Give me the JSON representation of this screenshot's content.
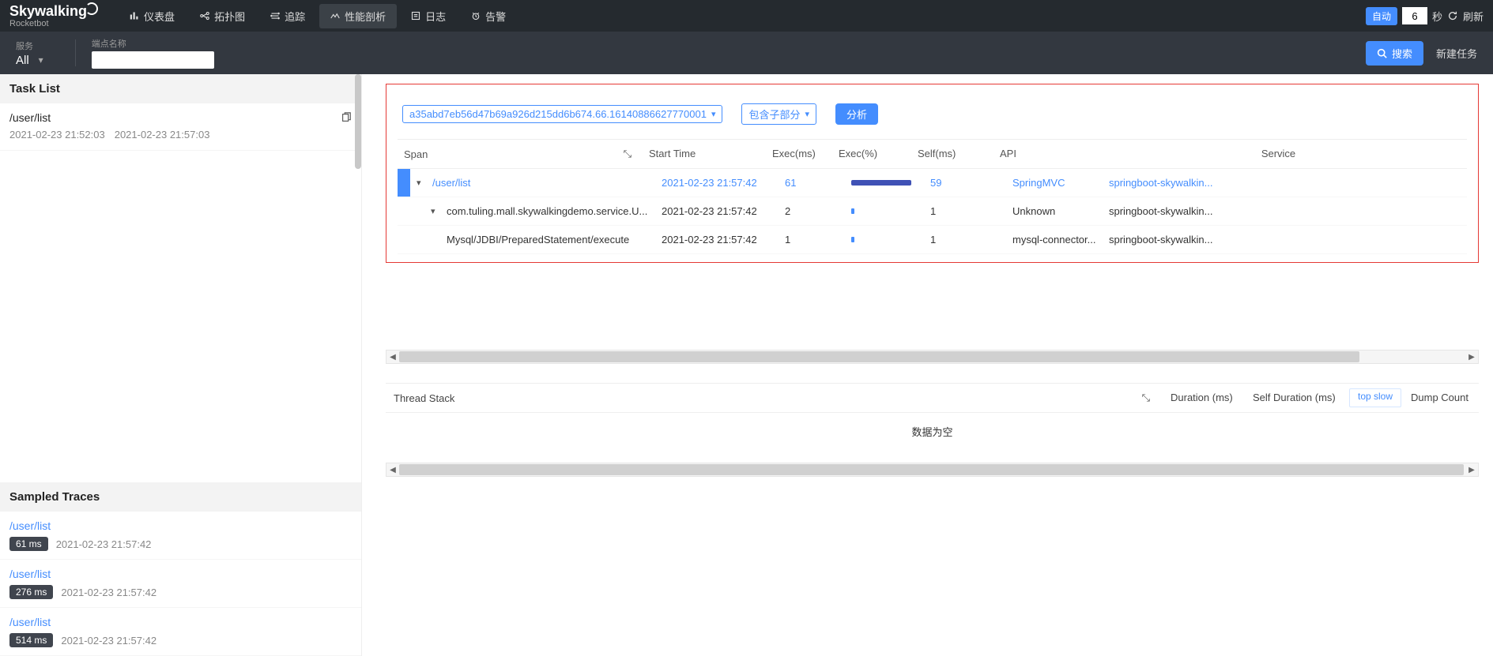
{
  "logo": {
    "main": "Skywalking",
    "sub": "Rocketbot"
  },
  "nav": {
    "dashboard": "仪表盘",
    "topology": "拓扑图",
    "trace": "追踪",
    "profile": "性能剖析",
    "log": "日志",
    "alarm": "告警"
  },
  "topright": {
    "auto": "自动",
    "seconds_value": "6",
    "seconds_unit": "秒",
    "refresh": "刷新"
  },
  "filter": {
    "service_label": "服务",
    "service_value": "All",
    "endpoint_label": "端点名称",
    "endpoint_value": "",
    "search": "搜索",
    "new_task": "新建任务"
  },
  "task_list": {
    "header": "Task List",
    "task_name": "/user/list",
    "start": "2021-02-23 21:52:03",
    "end": "2021-02-23 21:57:03"
  },
  "sampled": {
    "header": "Sampled Traces",
    "traces": [
      {
        "name": "/user/list",
        "ms": "61 ms",
        "time": "2021-02-23 21:57:42"
      },
      {
        "name": "/user/list",
        "ms": "276 ms",
        "time": "2021-02-23 21:57:42"
      },
      {
        "name": "/user/list",
        "ms": "514 ms",
        "time": "2021-02-23 21:57:42"
      }
    ]
  },
  "span_panel": {
    "trace_id": "a35abd7eb56d47b69a926d215dd6b674.66.16140886627770001",
    "include_children": "包含子部分",
    "analyze": "分析",
    "columns": {
      "span": "Span",
      "start": "Start Time",
      "exec": "Exec(ms)",
      "execpct": "Exec(%)",
      "self": "Self(ms)",
      "api": "API",
      "service": "Service"
    },
    "rows": [
      {
        "name": "/user/list",
        "start": "2021-02-23 21:57:42",
        "exec": "61",
        "pct": 100,
        "self": "59",
        "api": "SpringMVC",
        "svc": "springboot-skywalkin...",
        "depth": 0,
        "sel": true,
        "caret": "down"
      },
      {
        "name": "com.tuling.mall.skywalkingdemo.service.U...",
        "start": "2021-02-23 21:57:42",
        "exec": "2",
        "pct": 3,
        "self": "1",
        "api": "Unknown",
        "svc": "springboot-skywalkin...",
        "depth": 1,
        "sel": false,
        "caret": "down"
      },
      {
        "name": "Mysql/JDBI/PreparedStatement/execute",
        "start": "2021-02-23 21:57:42",
        "exec": "1",
        "pct": 2,
        "self": "1",
        "api": "mysql-connector...",
        "svc": "springboot-skywalkin...",
        "depth": 2,
        "sel": false,
        "caret": ""
      }
    ]
  },
  "thread_stack": {
    "header": "Thread Stack",
    "duration": "Duration (ms)",
    "self_duration": "Self Duration (ms)",
    "top_slow": "top slow",
    "dump_count": "Dump Count",
    "empty": "数据为空"
  }
}
